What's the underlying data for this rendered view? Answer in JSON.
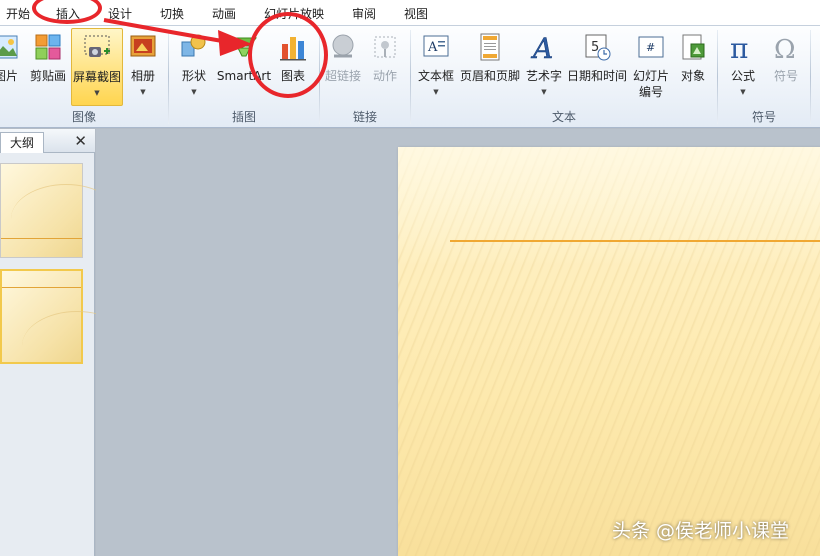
{
  "tabs": [
    {
      "id": "home",
      "label": "开始"
    },
    {
      "id": "insert",
      "label": "插入"
    },
    {
      "id": "design",
      "label": "设计"
    },
    {
      "id": "transitions",
      "label": "切换"
    },
    {
      "id": "animations",
      "label": "动画"
    },
    {
      "id": "slideshow",
      "label": "幻灯片放映"
    },
    {
      "id": "review",
      "label": "审阅"
    },
    {
      "id": "view",
      "label": "视图"
    }
  ],
  "ribbon": {
    "images": {
      "label": "图像",
      "picture": "图片",
      "clipart": "剪贴画",
      "screenshot": "屏幕截图",
      "album": "相册"
    },
    "illustrations": {
      "label": "插图",
      "shapes": "形状",
      "smartart": "SmartArt",
      "chart": "图表"
    },
    "links": {
      "label": "链接",
      "hyperlink": "超链接",
      "action": "动作"
    },
    "text": {
      "label": "文本",
      "textbox": "文本框",
      "header_footer": "页眉和页脚",
      "wordart": "艺术字",
      "datetime": "日期和时间",
      "slide_number_line1": "幻灯片",
      "slide_number_line2": "编号",
      "object": "对象"
    },
    "symbols": {
      "label": "符号",
      "equation": "公式",
      "symbol": "符号"
    }
  },
  "left_pane": {
    "outline_tab": "大纲",
    "close": "✕"
  },
  "watermark": "头条 @侯老师小课堂",
  "colors": {
    "annotation": "#e8262b",
    "slide_accent": "#f0a833",
    "slide_bg": "#fde9ad"
  }
}
